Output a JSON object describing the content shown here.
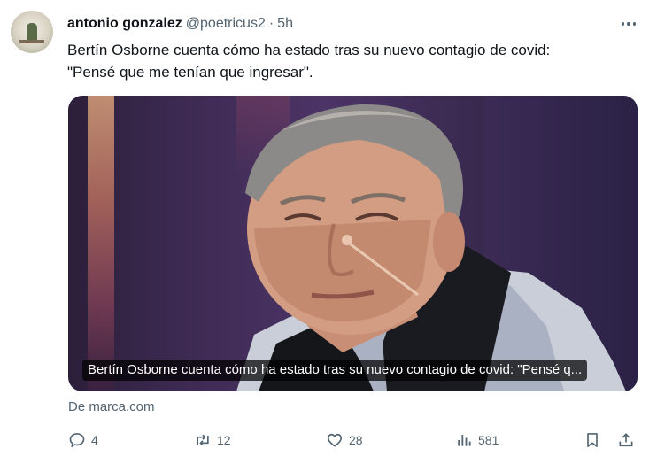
{
  "tweet": {
    "author_name": "antonio gonzalez",
    "handle": "@poetricus2",
    "separator": "·",
    "time": "5h",
    "text_line1": "Bertín Osborne cuenta cómo ha estado tras su nuevo contagio de covid:",
    "text_line2": "\"Pensé que me tenían que ingresar\"."
  },
  "card": {
    "caption": "Bertín Osborne cuenta cómo ha estado tras su nuevo contagio de covid: \"Pensé q...",
    "source": "De marca.com"
  },
  "actions": {
    "replies": "4",
    "reposts": "12",
    "likes": "28",
    "views": "581"
  },
  "colors": {
    "text": "#0f1419",
    "secondary": "#536471",
    "background": "#ffffff"
  },
  "icons": [
    "more-icon",
    "reply-icon",
    "repost-icon",
    "like-icon",
    "views-icon",
    "bookmark-icon",
    "share-icon"
  ]
}
